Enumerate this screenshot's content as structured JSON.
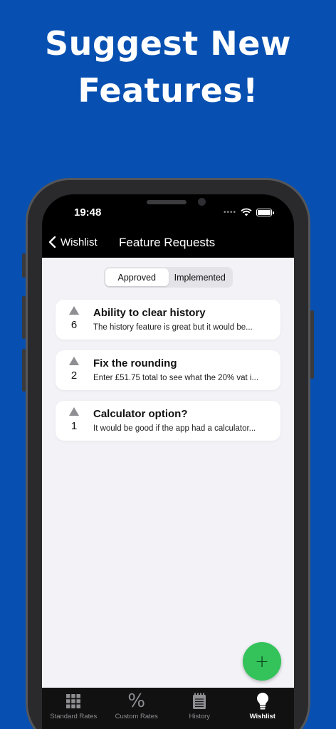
{
  "headline": {
    "line1": "Suggest New",
    "line2": "Features!"
  },
  "status": {
    "time": "19:48"
  },
  "nav": {
    "back_label": "Wishlist",
    "title": "Feature Requests"
  },
  "segments": {
    "approved": "Approved",
    "implemented": "Implemented"
  },
  "requests": [
    {
      "votes": "6",
      "title": "Ability to clear history",
      "description": "The history feature is great but it would be..."
    },
    {
      "votes": "2",
      "title": "Fix the rounding",
      "description": "Enter £51.75 total to see what the 20% vat i..."
    },
    {
      "votes": "1",
      "title": "Calculator option?",
      "description": "It would be good if the app had a calculator..."
    }
  ],
  "fab": {
    "label": "+"
  },
  "tabs": {
    "standard": "Standard Rates",
    "custom": "Custom Rates",
    "custom_icon": "%",
    "history": "History",
    "wishlist": "Wishlist"
  },
  "colors": {
    "background": "#0750b1",
    "fab": "#33c35a",
    "content": "#f2f2f7"
  }
}
